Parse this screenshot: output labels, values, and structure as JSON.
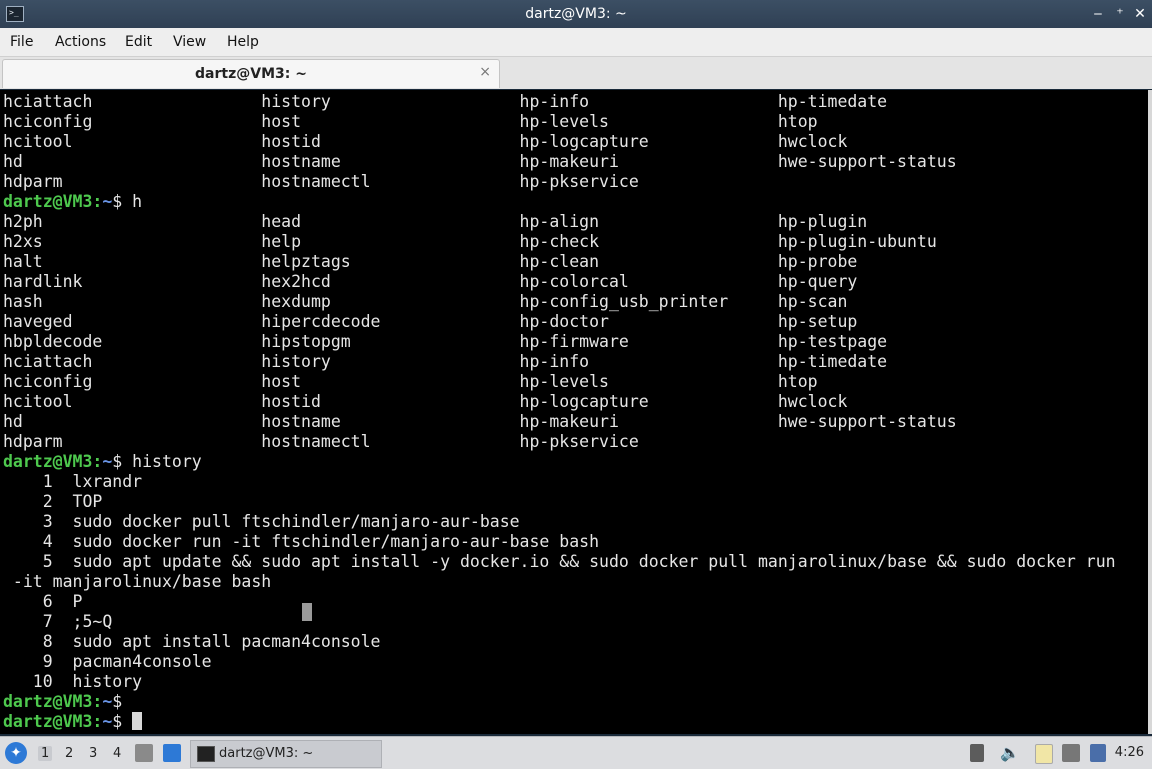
{
  "window": {
    "title": "dartz@VM3: ~",
    "icon": "terminal-icon",
    "controls": [
      "minimize",
      "maximize",
      "close"
    ]
  },
  "menu": [
    "File",
    "Actions",
    "Edit",
    "View",
    "Help"
  ],
  "tab": {
    "label": "dartz@VM3: ~",
    "close": "×"
  },
  "terminal": {
    "prompt_user": "dartz@VM3",
    "prompt_path": "~",
    "lines": [
      {
        "t": "hciattach                 history                   hp-info                   hp-timedate"
      },
      {
        "t": "hciconfig                 host                      hp-levels                 htop"
      },
      {
        "t": "hcitool                   hostid                    hp-logcapture             hwclock"
      },
      {
        "t": "hd                        hostname                  hp-makeuri                hwe-support-status"
      },
      {
        "t": "hdparm                    hostnamectl               hp-pkservice"
      },
      {
        "p": true,
        "t": "h"
      },
      {
        "t": "h2ph                      head                      hp-align                  hp-plugin"
      },
      {
        "t": "h2xs                      help                      hp-check                  hp-plugin-ubuntu"
      },
      {
        "t": "halt                      helpztags                 hp-clean                  hp-probe"
      },
      {
        "t": "hardlink                  hex2hcd                   hp-colorcal               hp-query"
      },
      {
        "t": "hash                      hexdump                   hp-config_usb_printer     hp-scan"
      },
      {
        "t": "haveged                   hipercdecode              hp-doctor                 hp-setup"
      },
      {
        "t": "hbpldecode                hipstopgm                 hp-firmware               hp-testpage"
      },
      {
        "t": "hciattach                 history                   hp-info                   hp-timedate"
      },
      {
        "t": "hciconfig                 host                      hp-levels                 htop"
      },
      {
        "t": "hcitool                   hostid                    hp-logcapture             hwclock"
      },
      {
        "t": "hd                        hostname                  hp-makeuri                hwe-support-status"
      },
      {
        "t": "hdparm                    hostnamectl               hp-pkservice"
      },
      {
        "p": true,
        "t": "history"
      },
      {
        "t": "    1  lxrandr"
      },
      {
        "t": "    2  TOP"
      },
      {
        "t": "    3  sudo docker pull ftschindler/manjaro-aur-base"
      },
      {
        "t": "    4  sudo docker run -it ftschindler/manjaro-aur-base bash"
      },
      {
        "t": "    5  sudo apt update && sudo apt install -y docker.io && sudo docker pull manjarolinux/base && sudo docker run"
      },
      {
        "t": " -it manjarolinux/base bash"
      },
      {
        "t": "    6  P"
      },
      {
        "t": "    7  ;5~Q"
      },
      {
        "t": "    8  sudo apt install pacman4console"
      },
      {
        "t": "    9  pacman4console"
      },
      {
        "t": "   10  history"
      },
      {
        "p": true,
        "t": ""
      },
      {
        "p": true,
        "t": "",
        "cursor": true
      }
    ]
  },
  "taskbar": {
    "workspaces": [
      "1",
      "2",
      "3",
      "4"
    ],
    "task_label": "dartz@VM3: ~",
    "clock": "4:26",
    "tray_icons": [
      "screen-icon",
      "volume-icon",
      "clipboard-icon",
      "network-icon",
      "update-icon"
    ]
  }
}
